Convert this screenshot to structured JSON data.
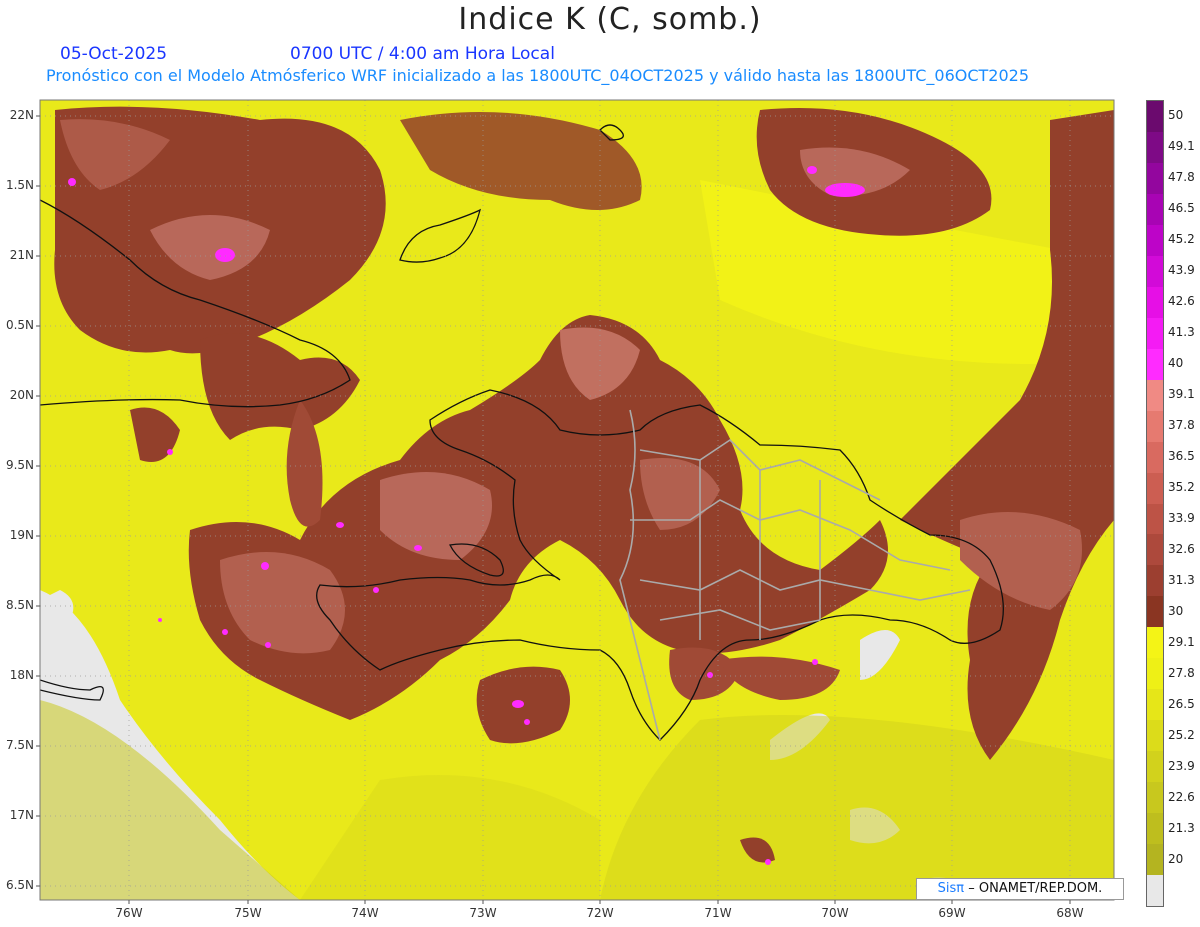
{
  "header": {
    "title": "Indice K (C, somb.)",
    "date": "05-Oct-2025",
    "time": "0700 UTC / 4:00 am Hora Local",
    "description": "Pronóstico con el Modelo Atmósferico WRF inicializado a las 1800UTC_04OCT2025 y válido hasta las  1800UTC_06OCT2025"
  },
  "axes": {
    "lat_labels": [
      "22N",
      "1.5N",
      "21N",
      "0.5N",
      "20N",
      "9.5N",
      "19N",
      "8.5N",
      "18N",
      "7.5N",
      "17N",
      "6.5N"
    ],
    "lon_labels": [
      "76W",
      "75W",
      "74W",
      "73W",
      "72W",
      "71W",
      "70W",
      "69W",
      "68W"
    ]
  },
  "colorbar": {
    "labels": [
      "50",
      "49.1",
      "47.8",
      "46.5",
      "45.2",
      "43.9",
      "42.6",
      "41.3",
      "40",
      "39.1",
      "37.8",
      "36.5",
      "35.2",
      "33.9",
      "32.6",
      "31.3",
      "30",
      "29.1",
      "27.8",
      "26.5",
      "25.2",
      "23.9",
      "22.6",
      "21.3",
      "20"
    ],
    "colors": [
      "#6b0a6e",
      "#7e0a86",
      "#93069e",
      "#a804b4",
      "#bd04c8",
      "#d20ad8",
      "#e60fe6",
      "#f41bf4",
      "#ff2bff",
      "#f08a84",
      "#e67a70",
      "#d96a60",
      "#cc5e52",
      "#bd5346",
      "#ad493c",
      "#9c3f30",
      "#8a3522",
      "#f4f416",
      "#eef016",
      "#e6e618",
      "#dcdc1a",
      "#d2d21c",
      "#c8c81e",
      "#bebe1e",
      "#b4b420"
    ],
    "below_color": "#e8e8e8"
  },
  "credit": {
    "logo_text": "Sisπ",
    "org_text": "– ONAMET/REP.DOM."
  }
}
